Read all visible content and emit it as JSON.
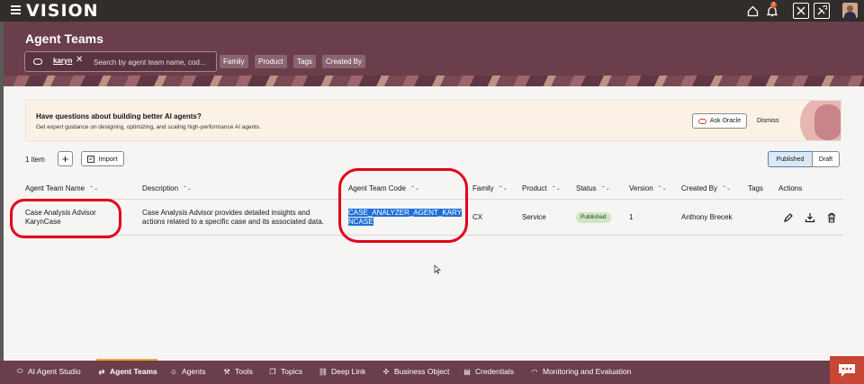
{
  "app": {
    "brand": "VISION",
    "notification_count": "2"
  },
  "header": {
    "title": "Agent Teams",
    "search": {
      "chip": "karyn",
      "placeholder": "Search by agent team name, cod..."
    },
    "filters": [
      "Family",
      "Product",
      "Tags",
      "Created By"
    ]
  },
  "banner": {
    "title": "Have questions about building better AI agents?",
    "subtitle": "Get expert guidance on designing, optimizing, and scaling high-performance AI agents.",
    "ask_label": "Ask Oracle",
    "dismiss_label": "Dismiss"
  },
  "toolbar": {
    "count": "1 item",
    "import_label": "Import",
    "published_label": "Published",
    "draft_label": "Draft"
  },
  "table": {
    "columns": [
      "Agent Team Name",
      "Description",
      "Agent Team Code",
      "Family",
      "Product",
      "Status",
      "Version",
      "Created By",
      "Tags",
      "Actions"
    ],
    "rows": [
      {
        "name_line1": "Case Analysis Advisor",
        "name_line2": "KarynCase",
        "desc_line1": "Case Analysis Advisor provides detailed insights and",
        "desc_line2": "actions related to a specific case and its associated data.",
        "code_line1": "CASE_ANALYZER_AGENT_KARY",
        "code_line2": "NCASE",
        "family": "CX",
        "product": "Service",
        "status": "Published",
        "version": "1",
        "created_by": "Anthony Brecek",
        "tags": ""
      }
    ]
  },
  "bottom_nav": [
    {
      "label": "AI Agent Studio",
      "icon": "studio-icon"
    },
    {
      "label": "Agent Teams",
      "icon": "agent-teams-icon"
    },
    {
      "label": "Agents",
      "icon": "agents-icon"
    },
    {
      "label": "Tools",
      "icon": "tools-icon"
    },
    {
      "label": "Topics",
      "icon": "topics-icon"
    },
    {
      "label": "Deep Link",
      "icon": "link-icon"
    },
    {
      "label": "Business Object",
      "icon": "business-object-icon"
    },
    {
      "label": "Credentials",
      "icon": "credentials-icon"
    },
    {
      "label": "Monitoring and Evaluation",
      "icon": "monitoring-icon"
    }
  ],
  "colors": {
    "header": "#6b3e4b",
    "topbar": "#312d2a",
    "accent": "#c74634",
    "annotation": "#e2001a"
  }
}
